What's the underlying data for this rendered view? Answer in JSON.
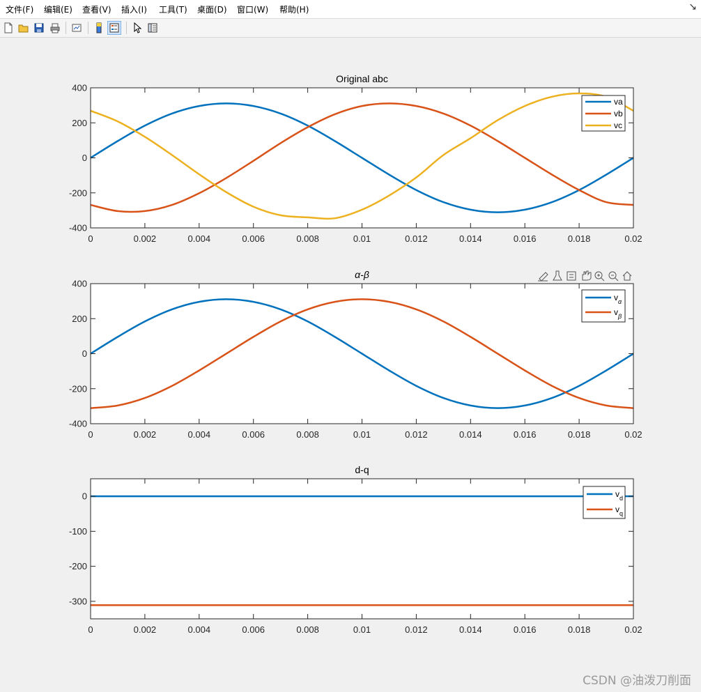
{
  "menu": [
    "文件(F)",
    "编辑(E)",
    "查看(V)",
    "插入(I)",
    "工具(T)",
    "桌面(D)",
    "窗口(W)",
    "帮助(H)"
  ],
  "window_control": "↘",
  "toolbar_icons": [
    "new-figure-icon",
    "open-file-icon",
    "save-icon",
    "print-icon",
    "link-plot-icon",
    "colorbar-icon",
    "legend-icon",
    "pointer-icon",
    "property-editor-icon"
  ],
  "axes_toolbar_icons": [
    "brush-icon",
    "data-tips-icon",
    "insert-legend-icon",
    "pan-icon",
    "zoom-in-icon",
    "zoom-out-icon",
    "home-icon"
  ],
  "watermark": "CSDN @油泼刀削面",
  "chart_data": [
    {
      "type": "line",
      "title": "Original abc",
      "xlim": [
        0,
        0.02
      ],
      "ylim": [
        -400,
        400
      ],
      "xticks": [
        0,
        0.002,
        0.004,
        0.006,
        0.008,
        0.01,
        0.012,
        0.014,
        0.016,
        0.018,
        0.02
      ],
      "xticklabels": [
        "0",
        "0.002",
        "0.004",
        "0.006",
        "0.008",
        "0.01",
        "0.012",
        "0.014",
        "0.016",
        "0.018",
        "0.02"
      ],
      "yticks": [
        400,
        200,
        0,
        -200,
        -400
      ],
      "yticklabels": [
        "400",
        "200",
        "0",
        "-200",
        "-400"
      ],
      "legend_position": "top-right",
      "series": [
        {
          "name": "va",
          "color": "#0072BD",
          "x": [
            0,
            0.001,
            0.002,
            0.003,
            0.004,
            0.005,
            0.006,
            0.007,
            0.008,
            0.009,
            0.01,
            0.011,
            0.012,
            0.013,
            0.014,
            0.015,
            0.016,
            0.017,
            0.018,
            0.019,
            0.02
          ],
          "values": [
            0,
            96,
            184,
            253,
            296,
            311,
            296,
            253,
            184,
            96,
            0,
            -96,
            -184,
            -253,
            -296,
            -311,
            -296,
            -253,
            -184,
            -96,
            0
          ]
        },
        {
          "name": "vb",
          "color": "#D95319",
          "x": [
            0,
            0.001,
            0.002,
            0.003,
            0.004,
            0.005,
            0.006,
            0.007,
            0.008,
            0.009,
            0.01,
            0.011,
            0.012,
            0.013,
            0.014,
            0.015,
            0.016,
            0.017,
            0.018,
            0.019,
            0.02
          ],
          "values": [
            -269,
            -304,
            -304,
            -269,
            -202,
            -115,
            -17,
            84,
            175,
            249,
            296,
            311,
            296,
            253,
            184,
            96,
            0,
            -96,
            -184,
            -253,
            -269
          ]
        },
        {
          "name": "vc",
          "color": "#EDB120",
          "x": [
            0,
            0.001,
            0.002,
            0.003,
            0.004,
            0.005,
            0.006,
            0.007,
            0.008,
            0.009,
            0.01,
            0.011,
            0.012,
            0.013,
            0.014,
            0.015,
            0.016,
            0.017,
            0.018,
            0.019,
            0.02
          ],
          "values": [
            269,
            208,
            120,
            16,
            -94,
            -196,
            -279,
            -328,
            -340,
            -345,
            -296,
            -215,
            -112,
            16,
            112,
            215,
            296,
            349,
            368,
            349,
            269
          ]
        }
      ]
    },
    {
      "type": "line",
      "title": "α-β",
      "xlim": [
        0,
        0.02
      ],
      "ylim": [
        -400,
        400
      ],
      "xticks": [
        0,
        0.002,
        0.004,
        0.006,
        0.008,
        0.01,
        0.012,
        0.014,
        0.016,
        0.018,
        0.02
      ],
      "xticklabels": [
        "0",
        "0.002",
        "0.004",
        "0.006",
        "0.008",
        "0.01",
        "0.012",
        "0.014",
        "0.016",
        "0.018",
        "0.02"
      ],
      "yticks": [
        400,
        200,
        0,
        -200,
        -400
      ],
      "yticklabels": [
        "400",
        "200",
        "0",
        "-200",
        "-400"
      ],
      "legend_position": "top-right",
      "series": [
        {
          "name": "v",
          "subscript": "α",
          "color": "#0072BD",
          "x": [
            0,
            0.001,
            0.002,
            0.003,
            0.004,
            0.005,
            0.006,
            0.007,
            0.008,
            0.009,
            0.01,
            0.011,
            0.012,
            0.013,
            0.014,
            0.015,
            0.016,
            0.017,
            0.018,
            0.019,
            0.02
          ],
          "values": [
            0,
            96,
            184,
            253,
            296,
            311,
            296,
            253,
            184,
            96,
            0,
            -96,
            -184,
            -253,
            -296,
            -311,
            -296,
            -253,
            -184,
            -96,
            0
          ]
        },
        {
          "name": "v",
          "subscript": "β",
          "color": "#D95319",
          "x": [
            0,
            0.001,
            0.002,
            0.003,
            0.004,
            0.005,
            0.006,
            0.007,
            0.008,
            0.009,
            0.01,
            0.011,
            0.012,
            0.013,
            0.014,
            0.015,
            0.016,
            0.017,
            0.018,
            0.019,
            0.02
          ],
          "values": [
            -311,
            -296,
            -253,
            -184,
            -96,
            0,
            96,
            184,
            253,
            296,
            311,
            296,
            253,
            184,
            96,
            0,
            -96,
            -184,
            -253,
            -296,
            -311
          ]
        }
      ]
    },
    {
      "type": "line",
      "title": "d-q",
      "xlim": [
        0,
        0.02
      ],
      "ylim": [
        -350,
        50
      ],
      "xticks": [
        0,
        0.002,
        0.004,
        0.006,
        0.008,
        0.01,
        0.012,
        0.014,
        0.016,
        0.018,
        0.02
      ],
      "xticklabels": [
        "0",
        "0.002",
        "0.004",
        "0.006",
        "0.008",
        "0.01",
        "0.012",
        "0.014",
        "0.016",
        "0.018",
        "0.02"
      ],
      "yticks": [
        0,
        -100,
        -200,
        -300
      ],
      "yticklabels": [
        "0",
        "-100",
        "-200",
        "-300"
      ],
      "legend_position": "top-right",
      "series": [
        {
          "name": "v",
          "subscript": "d",
          "color": "#0072BD",
          "x": [
            0,
            0.02
          ],
          "values": [
            0,
            0
          ]
        },
        {
          "name": "v",
          "subscript": "q",
          "color": "#D95319",
          "x": [
            0,
            0.02
          ],
          "values": [
            -311,
            -311
          ]
        }
      ]
    }
  ]
}
